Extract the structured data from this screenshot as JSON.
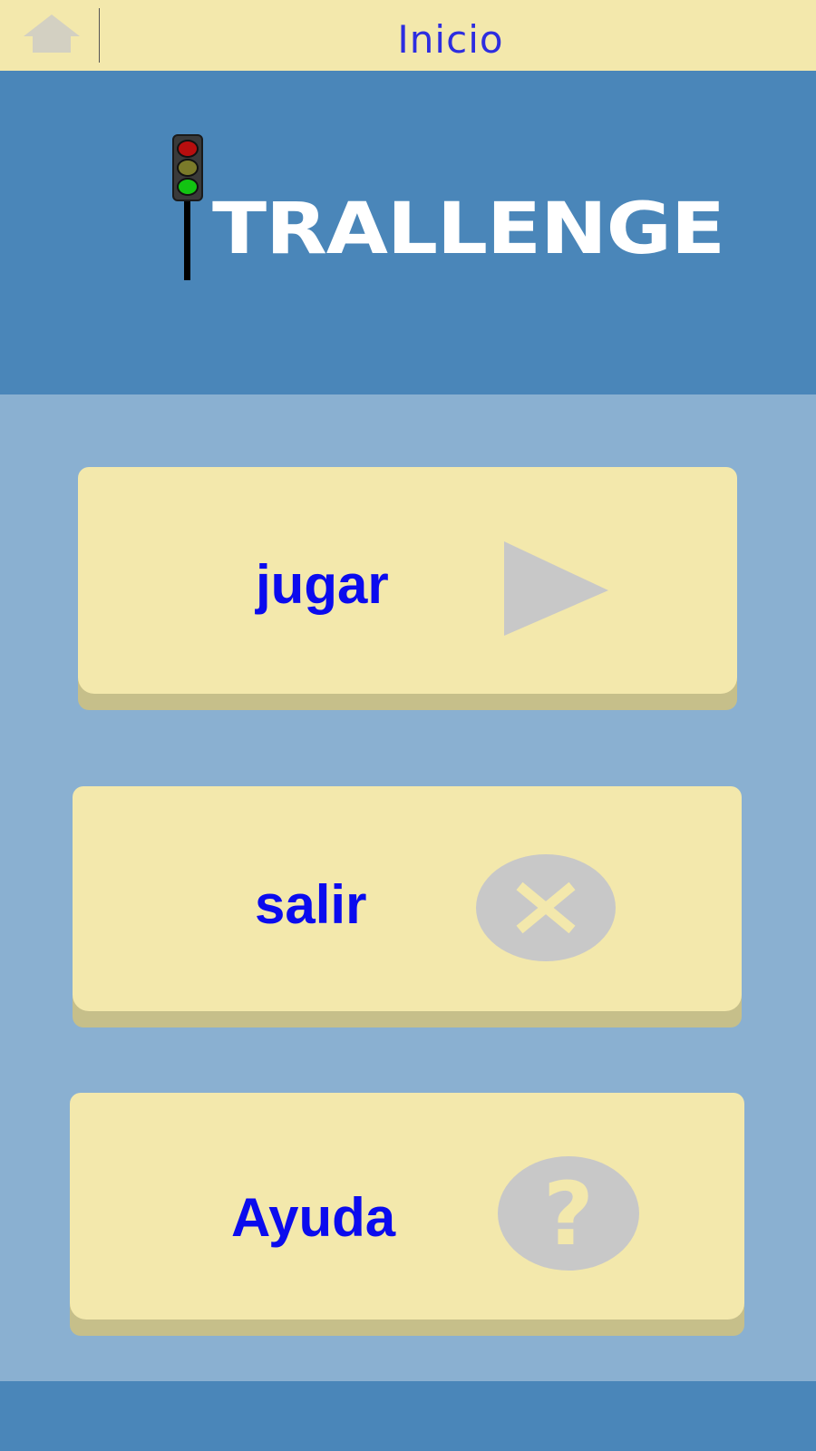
{
  "topbar": {
    "title": "Inicio",
    "home_icon": "home-icon"
  },
  "logo": {
    "text": "TRALLENGE",
    "icon": "traffic-light-icon"
  },
  "menu": {
    "items": [
      {
        "label": "jugar",
        "icon": "play-icon"
      },
      {
        "label": "salir",
        "icon": "close-icon"
      },
      {
        "label": "Ayuda",
        "icon": "help-icon"
      }
    ]
  },
  "colors": {
    "topbar_bg": "#f3e8ac",
    "header_bg": "#4a86b9",
    "body_bg": "#8ab0d1",
    "button_face": "#f3e8ac",
    "button_shadow": "#c6bf8a",
    "label_color": "#0b0bee",
    "title_color": "#2d2de0",
    "icon_gray": "#c8c8c8"
  }
}
